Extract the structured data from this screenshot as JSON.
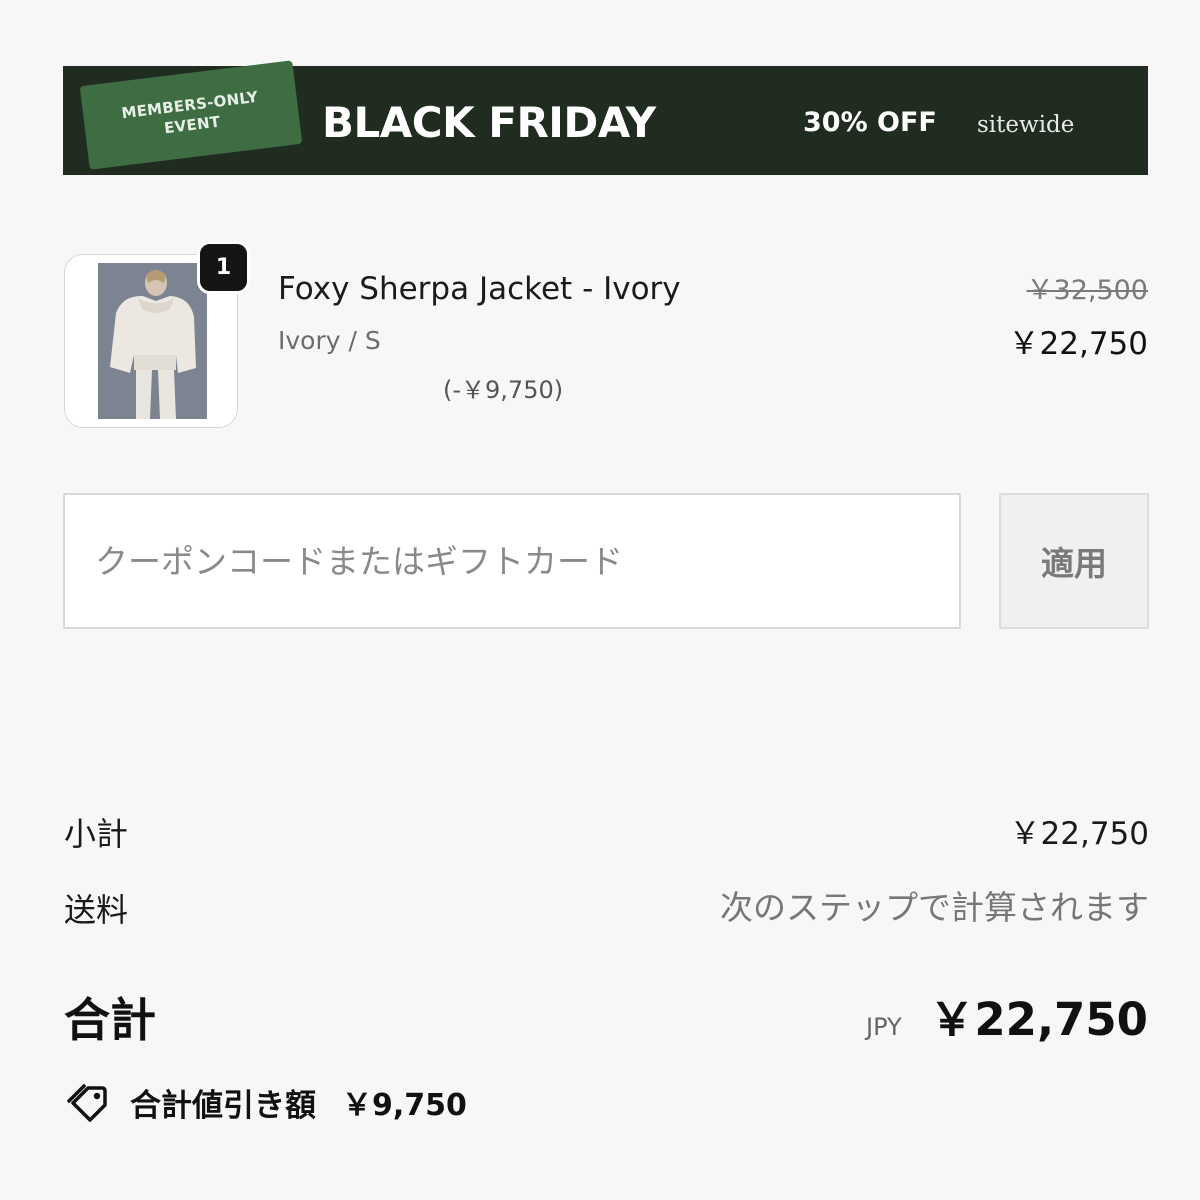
{
  "banner": {
    "badge_text": "MEMBERS-ONLY EVENT",
    "title": "BLACK FRIDAY",
    "offer": "30% OFF",
    "offer_suffix": "sitewide",
    "bg_color": "#1f2c1f",
    "badge_color": "#3f6d43"
  },
  "cart_item": {
    "quantity": "1",
    "name": "Foxy Sherpa Jacket - Ivory",
    "variant": "Ivory / S",
    "discount": "(-￥9,750)",
    "original_price": "￥32,500",
    "price": "￥22,750"
  },
  "coupon": {
    "placeholder": "クーポンコードまたはギフトカード",
    "value": "",
    "apply_label": "適用"
  },
  "summary": {
    "subtotal_label": "小計",
    "subtotal_value": "￥22,750",
    "shipping_label": "送料",
    "shipping_value": "次のステップで計算されます",
    "total_label": "合計",
    "currency": "JPY",
    "total_value": "￥22,750",
    "savings_icon": "tag-icon",
    "savings_label": "合計値引き額",
    "savings_value": "￥9,750"
  }
}
